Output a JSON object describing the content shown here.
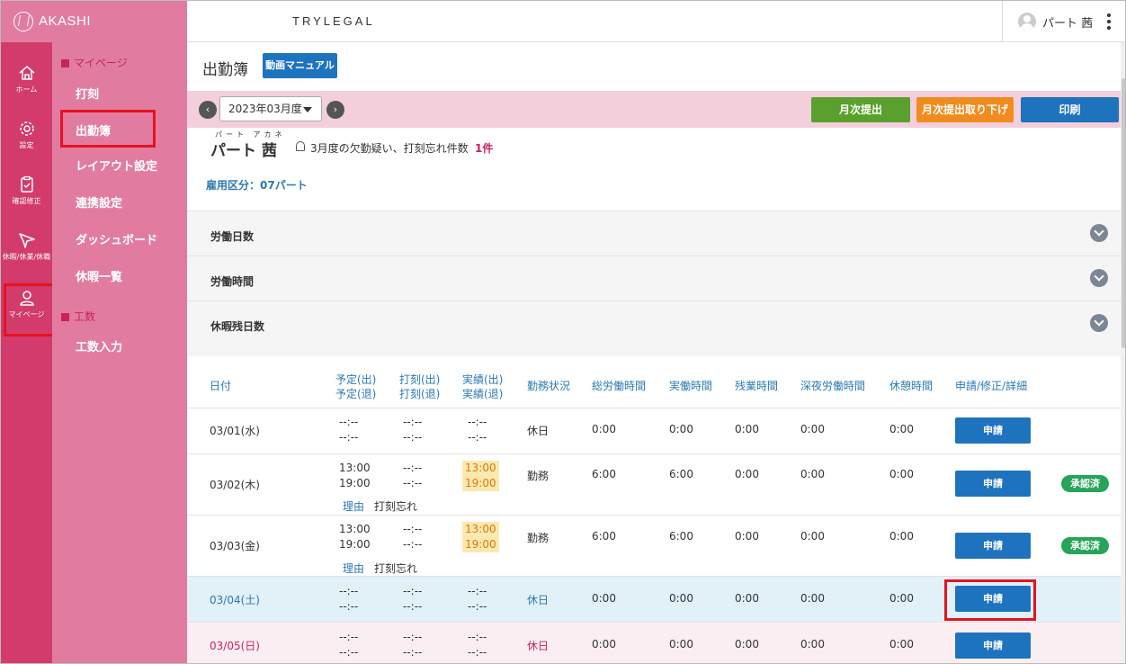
{
  "brand": {
    "logo_text": "AKASHI"
  },
  "header": {
    "company": "TRYLEGAL",
    "user_name": "パート 茜"
  },
  "rail": {
    "items": [
      {
        "label": "ホーム",
        "icon": "home-icon"
      },
      {
        "label": "設定",
        "icon": "gear-icon"
      },
      {
        "label": "確認修正",
        "icon": "clipboard-icon"
      },
      {
        "label": "休暇/休業/休職",
        "icon": "plane-icon"
      },
      {
        "label": "マイページ",
        "icon": "person-icon"
      }
    ]
  },
  "submenu": {
    "section1": "マイページ",
    "items1": [
      "打刻",
      "出勤簿",
      "レイアウト設定",
      "連携設定",
      "ダッシュボード",
      "休暇一覧"
    ],
    "section2": "工数",
    "items2": [
      "工数入力"
    ]
  },
  "page": {
    "title": "出勤簿",
    "manual_button": "動画マニュアル"
  },
  "toolbar": {
    "month": "2023年03月度",
    "prev": "‹",
    "next": "›",
    "submit": "月次提出",
    "withdraw": "月次提出取り下げ",
    "print": "印刷"
  },
  "employee": {
    "ruby": "パート アカネ",
    "name": "パート 茜",
    "alert_text": "3月度の欠勤疑い、打刻忘れ件数",
    "alert_count": "1件",
    "employment_type": "雇用区分：07パート"
  },
  "accordion": [
    "労働日数",
    "労働時間",
    "休暇残日数"
  ],
  "colors": {
    "accent": "#1e73be",
    "rail": "#d23b6c",
    "submenu": "#e17ca0",
    "monthbar": "#f3cfdc",
    "submit": "#5aa02c",
    "withdraw": "#f08c1e",
    "highlight": "#e8121e"
  },
  "table": {
    "headers": {
      "date": "日付",
      "scheduled_in": "予定(出)",
      "scheduled_out": "予定(退)",
      "stamp_in": "打刻(出)",
      "stamp_out": "打刻(退)",
      "actual_in": "実績(出)",
      "actual_out": "実績(退)",
      "status": "勤務状況",
      "total": "総労働時間",
      "work": "実働時間",
      "overtime": "残業時間",
      "night": "深夜労働時間",
      "break": "休憩時間",
      "apply": "申請/修正/詳細"
    },
    "apply_label": "申請",
    "approved_label": "承認済",
    "reason_label": "理由",
    "rows": [
      {
        "date": "03/01(水)",
        "sched_in": "--:--",
        "sched_out": "--:--",
        "stamp_in": "--:--",
        "stamp_out": "--:--",
        "act_in": "--:--",
        "act_out": "--:--",
        "status": "休日",
        "total": "0:00",
        "work": "0:00",
        "overtime": "0:00",
        "night": "0:00",
        "brk": "0:00"
      },
      {
        "date": "03/02(木)",
        "sched_in": "13:00",
        "sched_out": "19:00",
        "stamp_in": "--:--",
        "stamp_out": "--:--",
        "act_in": "13:00",
        "act_out": "19:00",
        "status": "勤務",
        "total": "6:00",
        "work": "6:00",
        "overtime": "0:00",
        "night": "0:00",
        "brk": "0:00",
        "reason": "打刻忘れ"
      },
      {
        "date": "03/03(金)",
        "sched_in": "13:00",
        "sched_out": "19:00",
        "stamp_in": "--:--",
        "stamp_out": "--:--",
        "act_in": "13:00",
        "act_out": "19:00",
        "status": "勤務",
        "total": "6:00",
        "work": "6:00",
        "overtime": "0:00",
        "night": "0:00",
        "brk": "0:00",
        "reason": "打刻忘れ"
      },
      {
        "date": "03/04(土)",
        "sched_in": "--:--",
        "sched_out": "--:--",
        "stamp_in": "--:--",
        "stamp_out": "--:--",
        "act_in": "--:--",
        "act_out": "--:--",
        "status": "休日",
        "total": "0:00",
        "work": "0:00",
        "overtime": "0:00",
        "night": "0:00",
        "brk": "0:00"
      },
      {
        "date": "03/05(日)",
        "sched_in": "--:--",
        "sched_out": "--:--",
        "stamp_in": "--:--",
        "stamp_out": "--:--",
        "act_in": "--:--",
        "act_out": "--:--",
        "status": "休日",
        "total": "0:00",
        "work": "0:00",
        "overtime": "0:00",
        "night": "0:00",
        "brk": "0:00"
      }
    ]
  }
}
